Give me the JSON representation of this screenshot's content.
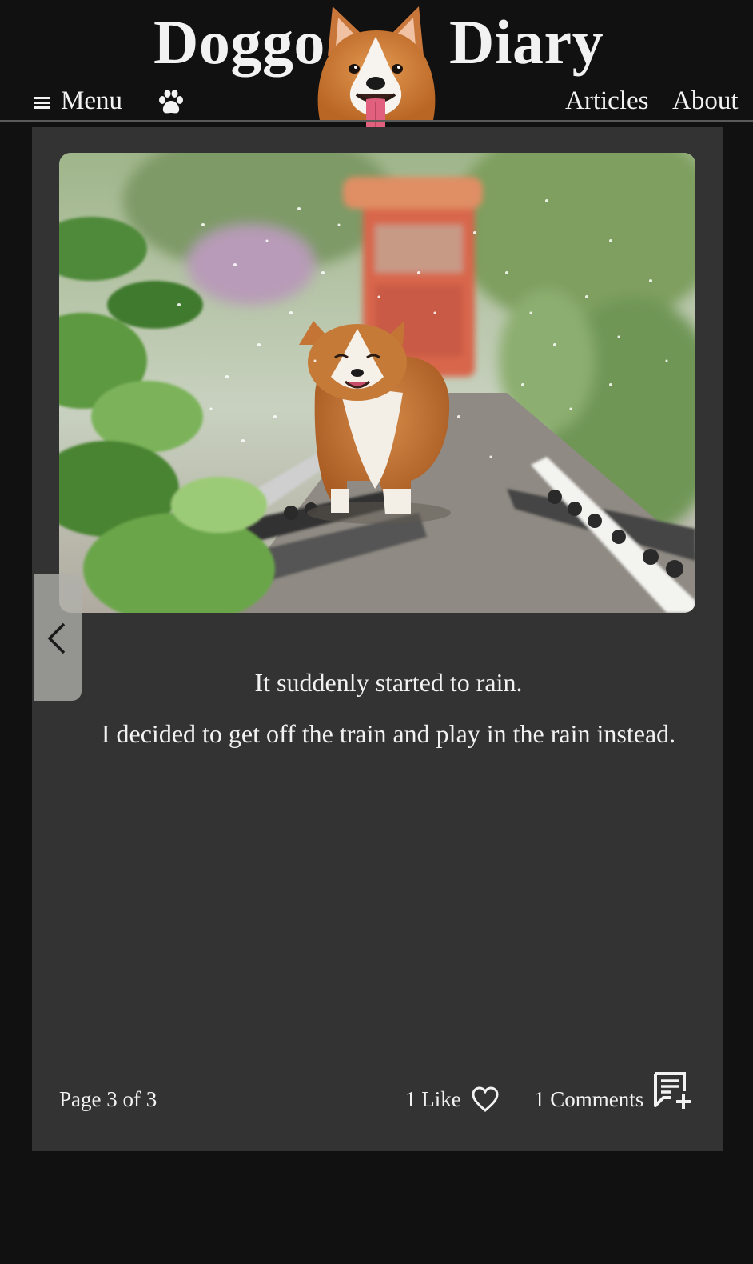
{
  "header": {
    "brand_left": "Doggo",
    "brand_right": "Diary",
    "menu_label": "Menu",
    "nav": {
      "articles": "Articles",
      "about": "About"
    }
  },
  "story": {
    "lines": [
      "It suddenly started to rain.",
      "I decided to get off the train and play in the rain instead."
    ]
  },
  "footer": {
    "page_indicator": "Page 3 of 3",
    "likes_label": "1 Like",
    "comments_label": "1 Comments"
  },
  "icons": {
    "menu": "hamburger-icon",
    "paw": "paw-icon",
    "prev": "chevron-left-icon",
    "like": "heart-outline-icon",
    "comment": "comment-add-icon"
  },
  "colors": {
    "page_bg": "#111111",
    "card_bg": "#333333",
    "text": "#f2f2f2",
    "prev_button_bg": "#afafaa"
  }
}
